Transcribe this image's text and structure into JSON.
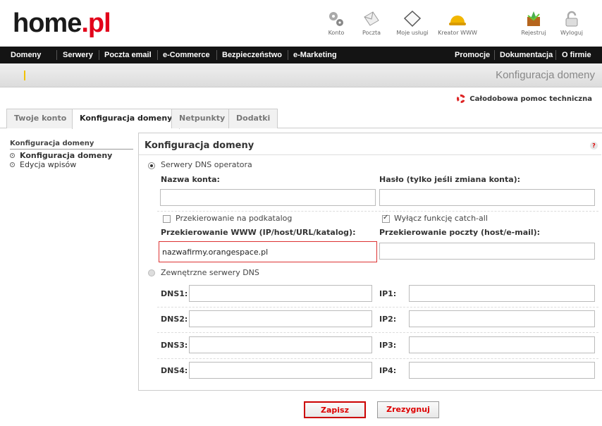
{
  "brand": {
    "prefix": "home",
    "accent": ".pl"
  },
  "top_icons": [
    {
      "label": "Konto",
      "icon": "gears-icon"
    },
    {
      "label": "Poczta",
      "icon": "envelope-icon"
    },
    {
      "label": "Moje usługi",
      "icon": "box-icon"
    },
    {
      "label": "Kreator WWW",
      "icon": "helmet-icon"
    },
    {
      "label": "Rejestruj",
      "icon": "register-icon"
    },
    {
      "label": "Wyloguj",
      "icon": "padlock-icon"
    }
  ],
  "nav_left": [
    "Domeny",
    "Serwery",
    "Poczta email",
    "e-Commerce",
    "Bezpieczeństwo",
    "e-Marketing"
  ],
  "nav_right": [
    "Promocje",
    "Dokumentacja",
    "O firmie"
  ],
  "page_title": "Konfiguracja domeny",
  "support_link": "Całodobowa pomoc techniczna",
  "tabs": [
    "Twoje konto",
    "Konfiguracja domeny",
    "Netpunkty",
    "Dodatki"
  ],
  "sidebar": {
    "heading": "Konfiguracja domeny",
    "items": [
      "Konfiguracja domeny",
      "Edycja wpisów"
    ]
  },
  "panel": {
    "title": "Konfiguracja domeny",
    "help": "?",
    "dns_operator_label": "Serwery DNS operatora",
    "account_name_label": "Nazwa konta:",
    "password_label": "Hasło (tylko jeśli zmiana konta):",
    "account_name_value": "",
    "password_value": "",
    "redirect_subdir_label": "Przekierowanie na podkatalog",
    "catchall_label": "Wyłącz funkcję catch-all",
    "www_redirect_label": "Przekierowanie WWW (IP/host/URL/katalog):",
    "mail_redirect_label": "Przekierowanie poczty (host/e-mail):",
    "www_redirect_value": "nazwafirmy.orangespace.pl",
    "mail_redirect_value": "",
    "external_dns_label": "Zewnętrzne serwery DNS",
    "dns_rows": [
      {
        "dns": "DNS1:",
        "ip": "IP1:"
      },
      {
        "dns": "DNS2:",
        "ip": "IP2:"
      },
      {
        "dns": "DNS3:",
        "ip": "IP3:"
      },
      {
        "dns": "DNS4:",
        "ip": "IP4:"
      }
    ]
  },
  "buttons": {
    "save": "Zapisz",
    "cancel": "Zrezygnuj"
  },
  "colors": {
    "accent": "#e2001a",
    "nav_bg": "#141414"
  }
}
